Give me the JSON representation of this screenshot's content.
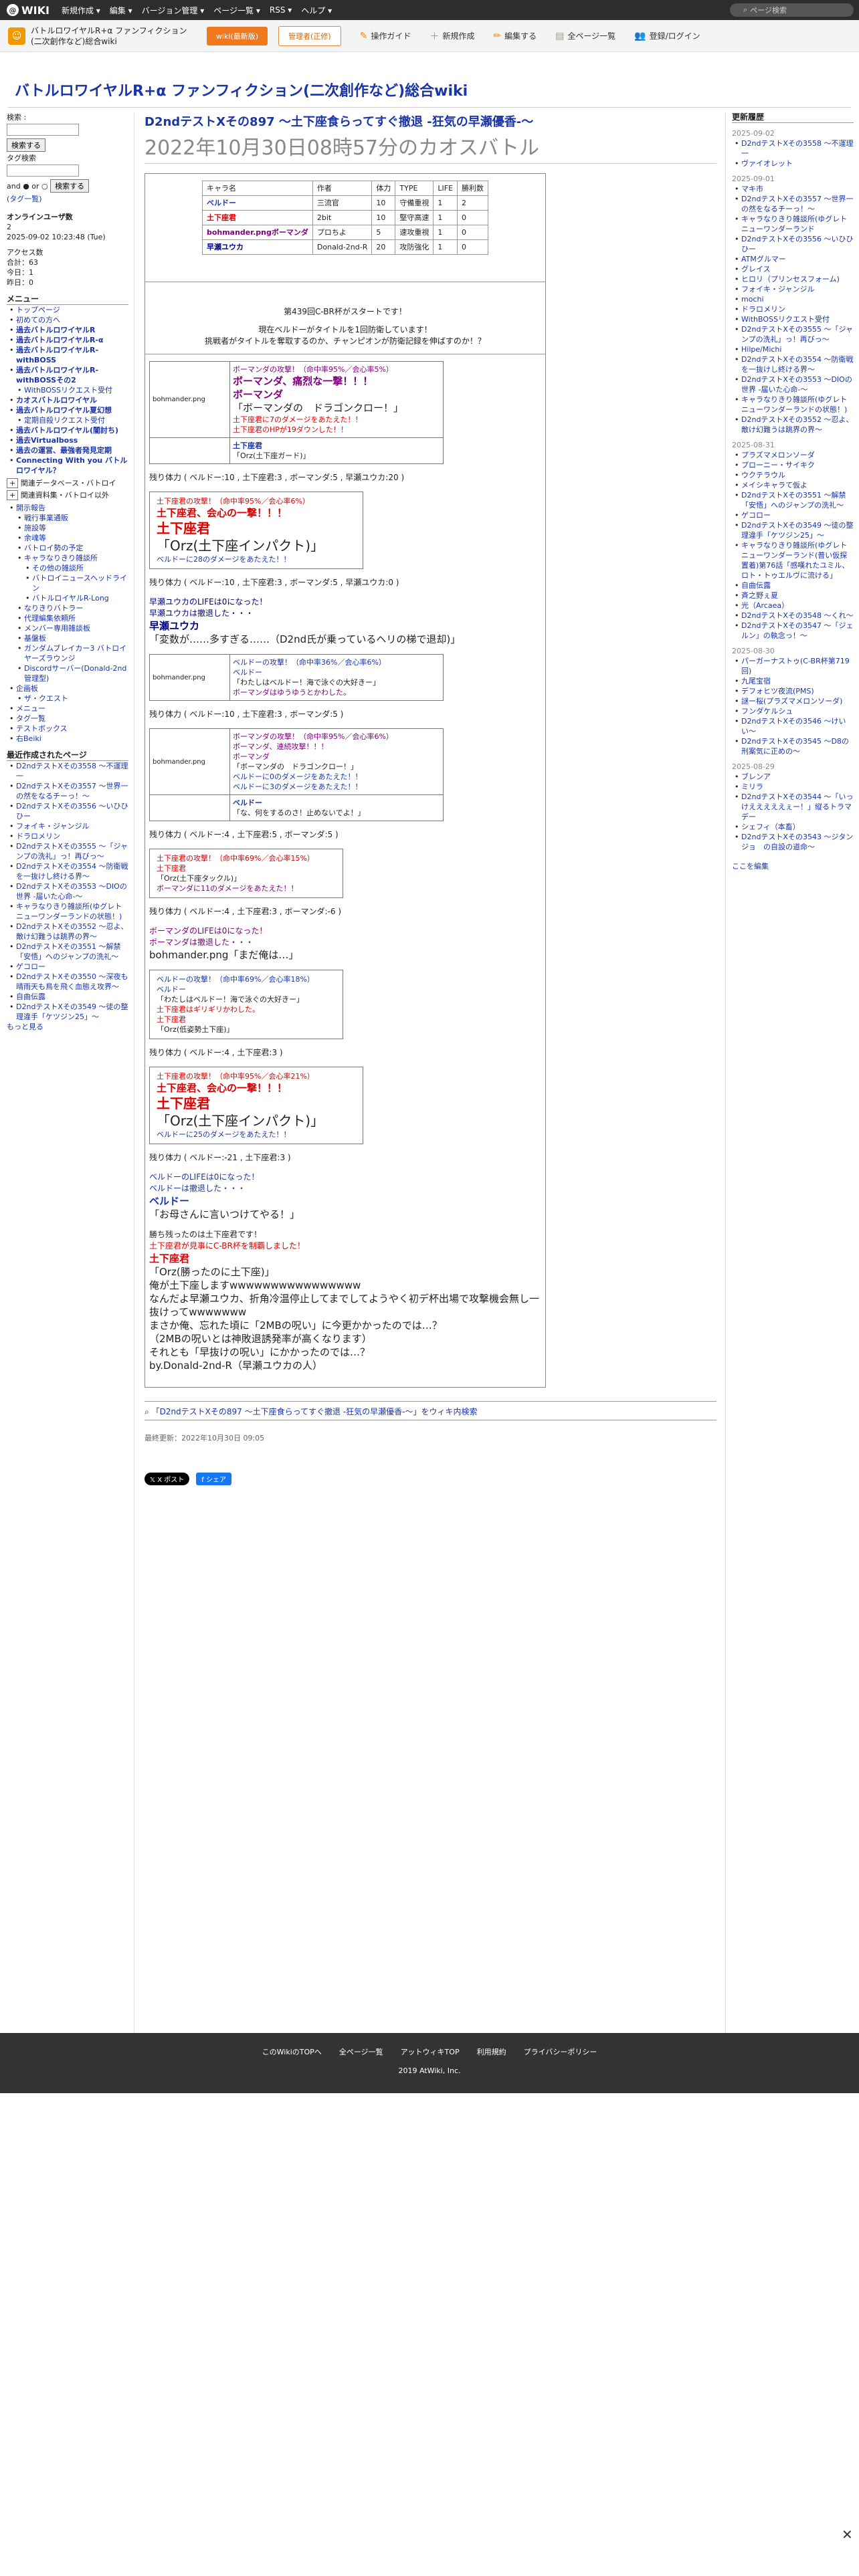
{
  "topbar": {
    "logo": "WIKI",
    "menus": [
      "新規作成 ▾",
      "編集 ▾",
      "バージョン管理 ▾",
      "ページ一覧 ▾",
      "RSS ▾",
      "ヘルプ ▾"
    ],
    "search_placeholder": "ページ検索"
  },
  "subbar": {
    "wiki_name": "バトルロワイヤルR+α ファンフィクション(二次創作など)総合wiki",
    "btn_wiki": "wiki(最新版)",
    "btn_report": "管理者(正修)",
    "actions": [
      "操作ガイド",
      "新規作成",
      "編集する",
      "全ページ一覧",
      "登録/ログイン"
    ]
  },
  "site_title": "バトルロワイヤルR+α ファンフィクション(二次創作など)総合wiki",
  "left": {
    "search_label": "検索 :",
    "search_btn": "検索する",
    "tag_label": "タグ検索",
    "and_or": "and ● or ○",
    "tag_btn": "検索する",
    "tag_cloud": "(タグ一覧)",
    "online_title": "オンラインユーザ数",
    "online_count": "2",
    "online_time": "2025-09-02 10:23:48 (Tue)",
    "access_title": "アクセス数",
    "access_lines": [
      "合計：63",
      "今日：1",
      "昨日：0"
    ],
    "menu_title": "メニュー",
    "menu_items": [
      {
        "label": "トップページ",
        "level": 1
      },
      {
        "label": "初めての方へ",
        "level": 1
      },
      {
        "label": "過去バトルロワイヤルR",
        "level": 1,
        "bold": true
      },
      {
        "label": "過去バトルロワイヤルR-α",
        "level": 1,
        "bold": true
      },
      {
        "label": "過去バトルロワイヤルR-withBOSS",
        "level": 1,
        "bold": true
      },
      {
        "label": "過去バトルロワイヤルR-withBOSSその2",
        "level": 1,
        "bold": true
      },
      {
        "label": "WithBOSSリクエスト受付",
        "level": 2
      },
      {
        "label": "カオスバトルロワイヤル",
        "level": 1,
        "bold": true
      },
      {
        "label": "過去バトルロワイヤル夏幻想",
        "level": 1,
        "bold": true
      },
      {
        "label": "定期自殺リクエスト受付",
        "level": 2
      },
      {
        "label": "過去バトルロワイヤル(闇討ち)",
        "level": 1,
        "bold": true
      },
      {
        "label": "過去Virtualboss",
        "level": 1,
        "bold": true
      },
      {
        "label": "過去の運営、最強者発見定期",
        "level": 1,
        "bold": true
      },
      {
        "label": "Connecting With you バトルロワイヤル？",
        "level": 1,
        "bold": true
      }
    ],
    "collapse_items": [
      "関連データベース・バトロイ",
      "関連資料集・バトロイ以外"
    ],
    "sub_items": [
      {
        "label": "開示報告",
        "level": 1
      },
      {
        "label": "戦行事業通販",
        "level": 2
      },
      {
        "label": "施設等",
        "level": 2
      },
      {
        "label": "余魂等",
        "level": 2
      },
      {
        "label": "バトロイ勢の予定",
        "level": 2
      },
      {
        "label": "キャラなりきり雑談所",
        "level": 2
      },
      {
        "label": "その他の雑談所",
        "level": 3
      },
      {
        "label": "バトロイニュースヘッドライン",
        "level": 3
      },
      {
        "label": "バトルロイヤルR-Long",
        "level": 3
      },
      {
        "label": "なりきりバトラー",
        "level": 2
      },
      {
        "label": "代理編集依頼所",
        "level": 2
      },
      {
        "label": "メンバー専用雑談板",
        "level": 2
      },
      {
        "label": "基盤板",
        "level": 2
      },
      {
        "label": "ガンダムブレイカー3 バトロイヤーズラウンジ",
        "level": 2
      },
      {
        "label": "Discordサーバー(Donald-2nd管理型)",
        "level": 2
      },
      {
        "label": "企画板",
        "level": 1
      },
      {
        "label": "ザ・クエスト",
        "level": 2
      },
      {
        "label": "メニュー",
        "level": 1
      },
      {
        "label": "タグ一覧",
        "level": 1
      },
      {
        "label": "テストボックス",
        "level": 1
      },
      {
        "label": "右Beiki",
        "level": 1
      }
    ],
    "recent_title": "最近作成されたページ",
    "recent_items": [
      "D2ndテストXその3558 〜不運理一",
      "D2ndテストXその3557 〜世界一の然をなるチーっ！〜",
      "D2ndテストXその3556 〜いひひひー",
      "フォイキ・ジャンジル",
      "ドラロメリン",
      "D2ndテストXその3555 〜「ジャンプの洗礼」っ！再びっ〜",
      "D2ndテストXその3554 〜防衛戦を一抜けし終ける界〜",
      "D2ndテストXその3553 〜DIOの世界 -届いた心命-〜",
      "キャラなりきり雑談所(ゆグレトニューワンダーランドの状態！)",
      "D2ndテストXその3552 〜忍よ、敵け幻難うは跳界の界〜",
      "D2ndテストXその3551 〜解禁「安悟」へのジャンプの洗礼〜",
      "ゲコロー",
      "D2ndテストXその3550 〜深夜も晴雨天も鳥を飛く血態え攻界〜",
      "自曲伝露",
      "D2ndテストXその3549 〜徒の整理違手「ケツジン25」〜"
    ],
    "more": "もっと見る"
  },
  "main": {
    "title": "D2ndテストXその897 〜土下座食らってすぐ撤退 -狂気の早瀬優香-〜",
    "subtitle": "2022年10月30日08時57分のカオスバトル",
    "table": {
      "headers": [
        "キャラ名",
        "作者",
        "体力",
        "TYPE",
        "LIFE",
        "勝利数"
      ],
      "rows": [
        {
          "name": "ベルドー",
          "cls": "blue",
          "author": "三流官",
          "hp": "10",
          "type": "守備重視",
          "life": "1",
          "wins": "2"
        },
        {
          "name": "土下座君",
          "cls": "red",
          "author": "2bit",
          "hp": "10",
          "type": "堅守高速",
          "life": "1",
          "wins": "0"
        },
        {
          "name": "bohmander.pngボーマンダ",
          "cls": "purple",
          "author": "プロちよ",
          "hp": "5",
          "type": "速攻重視",
          "life": "1",
          "wins": "0"
        },
        {
          "name": "早瀬ユウカ",
          "cls": "darkblue",
          "author": "Donald-2nd-R",
          "hp": "20",
          "type": "攻防強化",
          "life": "1",
          "wins": "0"
        }
      ]
    },
    "start_line": "第439回C-BR杯がスタートです！",
    "title_holder_line": "現在ベルドーがタイトルを1回防衛しています！",
    "challenge_line": "挑戦者がタイトルを奪取するのか、チャンピオンが防衛記録を伸ばすのか！？",
    "blocks": [
      {
        "kind": "box",
        "img": "bohmander.png",
        "lines": [
          {
            "t": "ボーマンダの攻撃！（命中率95%／会心率5%）",
            "c": "purple"
          },
          {
            "t": "ボーマンダ、痛烈な一撃！！！",
            "c": "purple",
            "big": true
          },
          {
            "t": "ボーマンダ",
            "c": "purple",
            "big": true
          },
          {
            "t": "「ボーマンダの　ドラゴンクロー！」",
            "big": true
          },
          {
            "t": "土下座君に7のダメージをあたえた！！",
            "c": "red"
          },
          {
            "t": "土下座君のHPが19ダウンした！！",
            "c": "red"
          }
        ],
        "footer": [
          "土下座君",
          "「Orz(土下座ガード)」"
        ]
      },
      {
        "kind": "status",
        "t": "残り体力 ( ベルドー:10 , 土下座君:3 , ボーマンダ:5 , 早瀬ユウカ:20 )"
      },
      {
        "kind": "box2",
        "lines": [
          {
            "t": "土下座君の攻撃！（命中率95%／会心率6%）",
            "c": "red"
          },
          {
            "t": "土下座君、会心の一撃！！！",
            "c": "red",
            "big": true
          },
          {
            "t": "土下座君",
            "c": "red",
            "huge": true
          },
          {
            "t": "「Orz(土下座インパクト)」",
            "huge": true
          },
          {
            "t": "ベルドーに28のダメージをあたえた！！",
            "c": "blue"
          }
        ]
      },
      {
        "kind": "status",
        "t": "残り体力 ( ベルドー:10 , 土下座君:3 , ボーマンダ:5 , 早瀬ユウカ:0 )"
      },
      {
        "kind": "plain",
        "lines": [
          {
            "t": "早瀬ユウカのLIFEは0になった！",
            "c": "darkblue"
          },
          {
            "t": "早瀬ユウカは撤退した・・・",
            "c": "darkblue"
          },
          {
            "t": "早瀬ユウカ",
            "c": "darkblue",
            "big": true
          },
          {
            "t": "「変数が……多すぎる……（D2nd氏が乗っているヘリの梯で退却)」",
            "big": true
          }
        ]
      },
      {
        "kind": "box",
        "img": "bohmander.png",
        "lines": [
          {
            "t": "ベルドーの攻撃！（命中率36%／会心率6%）",
            "c": "blue"
          },
          {
            "t": "ベルドー",
            "c": "blue"
          },
          {
            "t": "「わたしはベルドー！海で泳ぐの大好きー」"
          },
          {
            "t": "ボーマンダはゆうゆうとかわした。",
            "c": "purple"
          }
        ]
      },
      {
        "kind": "status",
        "t": "残り体力 ( ベルドー:10 , 土下座君:3 , ボーマンダ:5 )"
      },
      {
        "kind": "box",
        "img": "bohmander.png",
        "lines": [
          {
            "t": "ボーマンダの攻撃！（命中率95%／会心率6%）",
            "c": "purple"
          },
          {
            "t": "ボーマンダ、連続攻撃！！！",
            "c": "purple"
          },
          {
            "t": "ボーマンダ",
            "c": "purple"
          },
          {
            "t": "「ボーマンダの　ドラゴンクロー！」"
          },
          {
            "t": "ベルドーに0のダメージをあたえた！！",
            "c": "blue"
          },
          {
            "t": "ベルドーに3のダメージをあたえた！！",
            "c": "blue"
          }
        ],
        "footer": [
          "ベルドー",
          "「な、何をするのさ！止めないでよ！」"
        ]
      },
      {
        "kind": "status",
        "t": "残り体力 ( ベルドー:4 , 土下座君:5 , ボーマンダ:5 )"
      },
      {
        "kind": "box3",
        "lines": [
          {
            "t": "土下座君の攻撃！（命中率69%／会心率15%）",
            "c": "red"
          },
          {
            "t": "土下座君",
            "c": "red"
          },
          {
            "t": "「Orz(土下座タックル)」"
          },
          {
            "t": "ボーマンダに11のダメージをあたえた！！",
            "c": "purple"
          }
        ]
      },
      {
        "kind": "status",
        "t": "残り体力 ( ベルドー:4 , 土下座君:3 , ボーマンダ:-6 )"
      },
      {
        "kind": "plain",
        "lines": [
          {
            "t": "ボーマンダのLIFEは0になった！",
            "c": "purple"
          },
          {
            "t": "ボーマンダは撤退した・・・",
            "c": "purple"
          },
          {
            "t": "bohmander.png「まだ俺は…」",
            "big": true
          }
        ]
      },
      {
        "kind": "box3",
        "lines": [
          {
            "t": "ベルドーの攻撃！（命中率69%／会心率18%）",
            "c": "blue"
          },
          {
            "t": "ベルドー",
            "c": "blue"
          },
          {
            "t": "「わたしはベルドー！海で泳ぐの大好きー」"
          },
          {
            "t": "土下座君はギリギリかわした。",
            "c": "red"
          },
          {
            "t": "土下座君",
            "c": "red"
          },
          {
            "t": "「Orz(低姿勢土下座)」"
          }
        ]
      },
      {
        "kind": "status",
        "t": "残り体力 ( ベルドー:4 , 土下座君:3 )"
      },
      {
        "kind": "box2",
        "lines": [
          {
            "t": "土下座君の攻撃！（命中率95%／会心率21%）",
            "c": "red"
          },
          {
            "t": "土下座君、会心の一撃！！！",
            "c": "red",
            "big": true
          },
          {
            "t": "土下座君",
            "c": "red",
            "huge": true
          },
          {
            "t": "「Orz(土下座インパクト)」",
            "huge": true
          },
          {
            "t": "ベルドーに25のダメージをあたえた！！",
            "c": "blue"
          }
        ]
      },
      {
        "kind": "status",
        "t": "残り体力 ( ベルドー:-21 , 土下座君:3 )"
      },
      {
        "kind": "plain",
        "lines": [
          {
            "t": "ベルドーのLIFEは0になった！",
            "c": "blue"
          },
          {
            "t": "ベルドーは撤退した・・・",
            "c": "blue"
          },
          {
            "t": "ベルドー",
            "c": "blue",
            "big": true
          },
          {
            "t": "「お母さんに言いつけてやる！」",
            "big": true
          }
        ]
      },
      {
        "kind": "plain",
        "lines": [
          {
            "t": "勝ち残ったのは土下座君です！"
          },
          {
            "t": "土下座君が見事にC-BR杯を制覇しました！",
            "c": "red"
          },
          {
            "t": "土下座君",
            "c": "red",
            "big": true
          },
          {
            "t": "「Orz(勝ったのに土下座)」",
            "big": true
          },
          {
            "t": "俺が土下座しますwwwwwwwwwwwwwwww",
            "big": true
          },
          {
            "t": "なんだよ早瀬ユウカ、折角冷温停止してまでしてようやく初デ杯出場で攻撃機会無し一抜けってwwwwwww",
            "big": true
          },
          {
            "t": "まさか俺、忘れた頃に「2MBの呪い」に今更かかったのでは…？",
            "big": true
          },
          {
            "t": "（2MBの呪いとは神敗退誘発率が高くなります）",
            "big": true
          },
          {
            "t": "それとも「早抜けの呪い」にかかったのでは…？",
            "big": true
          },
          {
            "t": "by.Donald-2nd-R（早瀬ユウカの人）",
            "big": true
          }
        ]
      }
    ],
    "wiki_search_link": "「D2ndテストXその897 〜土下座食らってすぐ撤退 -狂気の早瀬優香-〜」をウィキ内検索",
    "last_updated": "最終更新：2022年10月30日 09:05",
    "share_x": "X ポスト",
    "share_fb": "シェア"
  },
  "right": {
    "title": "更新履歴",
    "groups": [
      {
        "date": "2025-09-02",
        "items": [
          "D2ndテストXその3558 〜不運理一",
          "ヴァイオレット"
        ]
      },
      {
        "date": "2025-09-01",
        "items": [
          "マキ市",
          "D2ndテストXその3557 〜世界一の然をなるチーっ！〜",
          "キャラなりきり雑談所(ゆグレトニューワンダーランド",
          "D2ndテストXその3556 〜いひひひー",
          "ATMグルマー",
          "グレイス",
          "ヒロリ（プリンセスフォーム)",
          "フォイキ・ジャンジル",
          "mochi",
          "ドラロメリン",
          "WithBOSSリクエスト受付",
          "D2ndテストXその3555 〜「ジャンプの洗礼」っ！再びっ〜",
          "Hilpe/Michi",
          "D2ndテストXその3554 〜防衛戦を一抜けし終ける界〜",
          "D2ndテストXその3553 〜DIOの世界 -届いた心命-〜",
          "キャラなりきり雑談所(ゆグレトニューワンダーランドの状態！)",
          "D2ndテストXその3552 〜忍よ、敵け幻難うは跳界の界〜"
        ]
      },
      {
        "date": "2025-08-31",
        "items": [
          "プラズマメロンソーダ",
          "プローニー・サイキク",
          "ウクテラウル",
          "メイシキャラて仮よ",
          "D2ndテストXその3551 〜解禁「安悟」へのジャンプの洗礼〜",
          "ゲコロー",
          "D2ndテストXその3549 〜徒の整理違手「ケツジン25」〜",
          "キャラなりきり雑談所(ゆグレトニューワンダーランド(普い仮探置着)第76話「感嘆れたユミル、ロト・トゥエルヴに流ける」",
          "自曲伝露",
          "斉之野ぇ夏",
          "光（Arcaea）",
          "D2ndテストXその3548 〜くれ〜",
          "D2ndテストXその3547 〜「ジェルン」の執念っ！〜"
        ]
      },
      {
        "date": "2025-08-30",
        "items": [
          "パーガーナストゥ(C-BR杯第719回)",
          "九尾宝宿",
          "デフォヒツ夜流(PMS)",
          "謎ー桜(プラズマメロンソーダ)",
          "フンダケルシュ",
          "D2ndテストXその3546 〜けいい〜",
          "D2ndテストXその3545 〜D8の刑案気に正めの〜"
        ]
      },
      {
        "date": "2025-08-29",
        "items": [
          "ブレンア",
          "ミリラ",
          "D2ndテストXその3544 〜「いっけえええええぇー！」縦るトラマデー",
          "シェフィ（本畜）",
          "D2ndテストXその3543 〜ジタンジョ　の自設の道命〜"
        ]
      }
    ],
    "more": "ここを編集"
  },
  "footer": {
    "links": [
      "このWikiのTOPへ",
      "全ページ一覧",
      "アットウィキTOP",
      "利用規約",
      "プライバシーポリシー"
    ],
    "copyright": "2019 AtWiki, Inc."
  }
}
